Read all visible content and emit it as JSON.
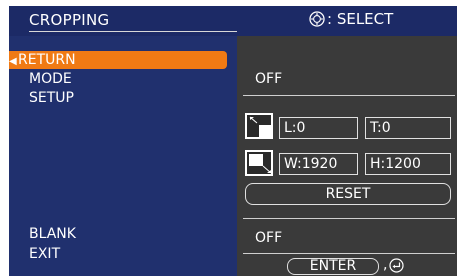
{
  "header": {
    "title": "CROPPING",
    "select_label": ": SELECT",
    "select_icon": "dpad-icon"
  },
  "menu": {
    "items": [
      {
        "label": "RETURN",
        "active": true
      },
      {
        "label": "MODE"
      },
      {
        "label": "SETUP"
      },
      {
        "label": "BLANK"
      },
      {
        "label": "EXIT"
      }
    ]
  },
  "settings": {
    "mode_value": "OFF",
    "left_value": "L:0",
    "top_value": "T:0",
    "width_value": "W:1920",
    "height_value": "H:1200",
    "reset_label": "RESET",
    "blank_value": "OFF",
    "enter_label": "ENTER",
    "enter_suffix": ","
  },
  "colors": {
    "title_bg": "#1c2a66",
    "menu_bg": "#20306e",
    "panel_bg": "#3a3a3a",
    "accent": "#f07a14"
  }
}
